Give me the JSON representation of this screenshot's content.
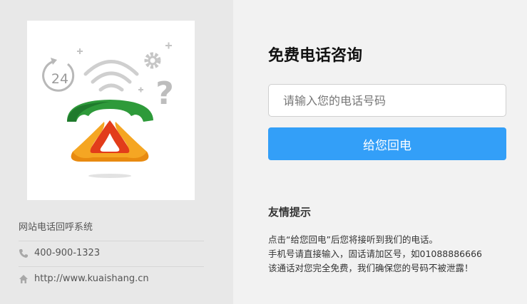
{
  "sidebar": {
    "logo_icon": "phone-callback-24h-icon",
    "system_name": "网站电话回呼系统",
    "phone": {
      "icon": "phone-icon",
      "text": "400-900-1323"
    },
    "website": {
      "icon": "home-icon",
      "text": "http://www.kuaishang.cn"
    }
  },
  "form": {
    "title": "免费电话咨询",
    "phone_placeholder": "请输入您的电话号码",
    "phone_value": "",
    "submit_label": "给您回电"
  },
  "tips": {
    "title": "友情提示",
    "lines": [
      "点击“给您回电”后您将接听到我们的电话。",
      "手机号请直接输入，固话请加区号，如01088886666",
      "该通话对您完全免费，我们确保您的号码不被泄露！"
    ]
  },
  "colors": {
    "button": "#339ff8",
    "left_panel": "#e8e8e8",
    "right_panel": "#f2f2f2",
    "handset_green": "#2e9a3a",
    "base_orange": "#f0a020"
  }
}
